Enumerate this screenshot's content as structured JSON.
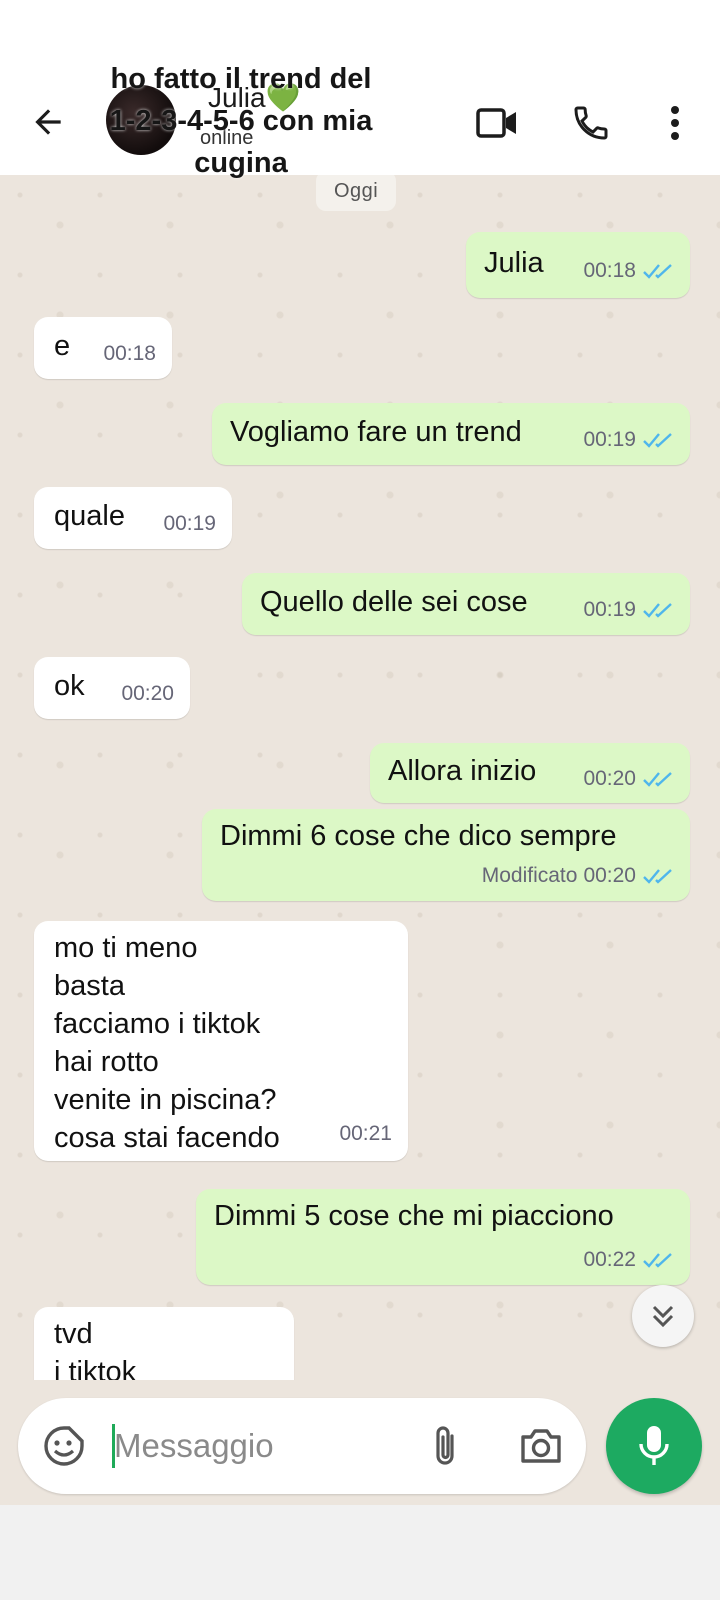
{
  "overlay": {
    "line1": "ho fatto il trend del",
    "line2": "1-2-3-4-5-6 con mia",
    "line3": "cugina"
  },
  "header": {
    "contact_name": "Julia💚",
    "status": "online",
    "icons": [
      "back-arrow-icon",
      "video-call-icon",
      "phone-icon",
      "more-vert-icon"
    ]
  },
  "chat": {
    "date_chip": "Oggi",
    "messages": [
      {
        "dir": "out",
        "text": "Julia",
        "time": "00:18",
        "status": "read"
      },
      {
        "dir": "in",
        "text": "e",
        "time": "00:18"
      },
      {
        "dir": "out",
        "text": "Vogliamo fare un trend",
        "time": "00:19",
        "status": "read"
      },
      {
        "dir": "in",
        "text": "quale",
        "time": "00:19"
      },
      {
        "dir": "out",
        "text": "Quello delle sei cose",
        "time": "00:19",
        "status": "read"
      },
      {
        "dir": "in",
        "text": "ok",
        "time": "00:20"
      },
      {
        "dir": "out",
        "text": "Allora inizio",
        "time": "00:20",
        "status": "read"
      },
      {
        "dir": "out",
        "text": "Dimmi 6 cose che dico sempre",
        "edited": "Modificato",
        "time": "00:20",
        "status": "read"
      },
      {
        "dir": "in",
        "text": "mo ti meno\nbasta\nfacciamo i tiktok\nhai rotto\nvenite in piscina?\ncosa stai facendo",
        "time": "00:21"
      },
      {
        "dir": "out",
        "text": "Dimmi 5 cose che mi piacciono",
        "time": "00:22",
        "status": "read"
      },
      {
        "dir": "in",
        "text": "tvd\ni tiktok",
        "time": ""
      }
    ]
  },
  "composer": {
    "placeholder": "Messaggio",
    "icons": [
      "sticker-emoji-icon",
      "paperclip-icon",
      "camera-icon",
      "microphone-icon"
    ]
  },
  "colors": {
    "outgoing_bubble": "#dcf8c6",
    "incoming_bubble": "#ffffff",
    "chat_background": "#ece5dd",
    "read_ticks": "#4fb6ec",
    "mic_button": "#1daa61"
  }
}
